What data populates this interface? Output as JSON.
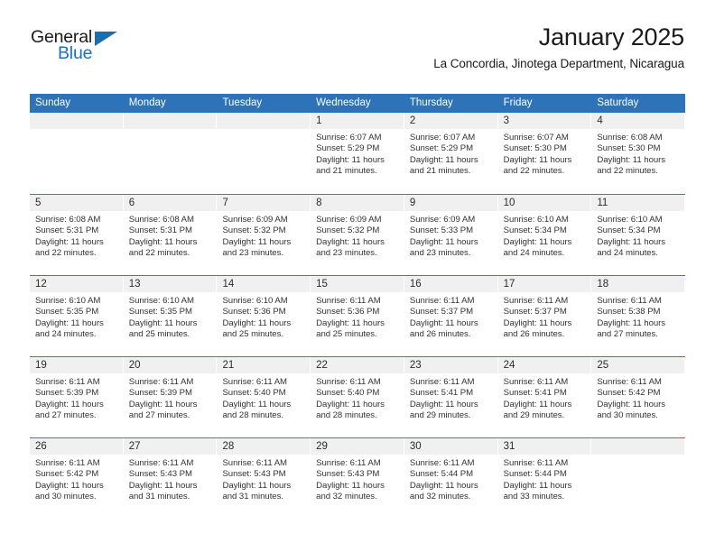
{
  "brand": {
    "word_one": "General",
    "word_two": "Blue",
    "triangle_icon": "triangle-icon",
    "accent_color": "#1673c4",
    "triangle_color": "#1b6cb0"
  },
  "header": {
    "title": "January 2025",
    "subtitle": "La Concordia, Jinotega Department, Nicaragua"
  },
  "colors": {
    "header_bar": "#2e72b8",
    "week_divider": "#3a7cbe",
    "day_band": "#f0f0f0",
    "text": "#333333"
  },
  "calendar": {
    "day_headers": [
      "Sunday",
      "Monday",
      "Tuesday",
      "Wednesday",
      "Thursday",
      "Friday",
      "Saturday"
    ],
    "weeks": [
      [
        {
          "day": "",
          "sunrise": "",
          "sunset": "",
          "daylight_1": "",
          "daylight_2": "",
          "empty": true
        },
        {
          "day": "",
          "sunrise": "",
          "sunset": "",
          "daylight_1": "",
          "daylight_2": "",
          "empty": true
        },
        {
          "day": "",
          "sunrise": "",
          "sunset": "",
          "daylight_1": "",
          "daylight_2": "",
          "empty": true
        },
        {
          "day": "1",
          "sunrise": "Sunrise: 6:07 AM",
          "sunset": "Sunset: 5:29 PM",
          "daylight_1": "Daylight: 11 hours",
          "daylight_2": "and 21 minutes."
        },
        {
          "day": "2",
          "sunrise": "Sunrise: 6:07 AM",
          "sunset": "Sunset: 5:29 PM",
          "daylight_1": "Daylight: 11 hours",
          "daylight_2": "and 21 minutes."
        },
        {
          "day": "3",
          "sunrise": "Sunrise: 6:07 AM",
          "sunset": "Sunset: 5:30 PM",
          "daylight_1": "Daylight: 11 hours",
          "daylight_2": "and 22 minutes."
        },
        {
          "day": "4",
          "sunrise": "Sunrise: 6:08 AM",
          "sunset": "Sunset: 5:30 PM",
          "daylight_1": "Daylight: 11 hours",
          "daylight_2": "and 22 minutes."
        }
      ],
      [
        {
          "day": "5",
          "sunrise": "Sunrise: 6:08 AM",
          "sunset": "Sunset: 5:31 PM",
          "daylight_1": "Daylight: 11 hours",
          "daylight_2": "and 22 minutes."
        },
        {
          "day": "6",
          "sunrise": "Sunrise: 6:08 AM",
          "sunset": "Sunset: 5:31 PM",
          "daylight_1": "Daylight: 11 hours",
          "daylight_2": "and 22 minutes."
        },
        {
          "day": "7",
          "sunrise": "Sunrise: 6:09 AM",
          "sunset": "Sunset: 5:32 PM",
          "daylight_1": "Daylight: 11 hours",
          "daylight_2": "and 23 minutes."
        },
        {
          "day": "8",
          "sunrise": "Sunrise: 6:09 AM",
          "sunset": "Sunset: 5:32 PM",
          "daylight_1": "Daylight: 11 hours",
          "daylight_2": "and 23 minutes."
        },
        {
          "day": "9",
          "sunrise": "Sunrise: 6:09 AM",
          "sunset": "Sunset: 5:33 PM",
          "daylight_1": "Daylight: 11 hours",
          "daylight_2": "and 23 minutes."
        },
        {
          "day": "10",
          "sunrise": "Sunrise: 6:10 AM",
          "sunset": "Sunset: 5:34 PM",
          "daylight_1": "Daylight: 11 hours",
          "daylight_2": "and 24 minutes."
        },
        {
          "day": "11",
          "sunrise": "Sunrise: 6:10 AM",
          "sunset": "Sunset: 5:34 PM",
          "daylight_1": "Daylight: 11 hours",
          "daylight_2": "and 24 minutes."
        }
      ],
      [
        {
          "day": "12",
          "sunrise": "Sunrise: 6:10 AM",
          "sunset": "Sunset: 5:35 PM",
          "daylight_1": "Daylight: 11 hours",
          "daylight_2": "and 24 minutes."
        },
        {
          "day": "13",
          "sunrise": "Sunrise: 6:10 AM",
          "sunset": "Sunset: 5:35 PM",
          "daylight_1": "Daylight: 11 hours",
          "daylight_2": "and 25 minutes."
        },
        {
          "day": "14",
          "sunrise": "Sunrise: 6:10 AM",
          "sunset": "Sunset: 5:36 PM",
          "daylight_1": "Daylight: 11 hours",
          "daylight_2": "and 25 minutes."
        },
        {
          "day": "15",
          "sunrise": "Sunrise: 6:11 AM",
          "sunset": "Sunset: 5:36 PM",
          "daylight_1": "Daylight: 11 hours",
          "daylight_2": "and 25 minutes."
        },
        {
          "day": "16",
          "sunrise": "Sunrise: 6:11 AM",
          "sunset": "Sunset: 5:37 PM",
          "daylight_1": "Daylight: 11 hours",
          "daylight_2": "and 26 minutes."
        },
        {
          "day": "17",
          "sunrise": "Sunrise: 6:11 AM",
          "sunset": "Sunset: 5:37 PM",
          "daylight_1": "Daylight: 11 hours",
          "daylight_2": "and 26 minutes."
        },
        {
          "day": "18",
          "sunrise": "Sunrise: 6:11 AM",
          "sunset": "Sunset: 5:38 PM",
          "daylight_1": "Daylight: 11 hours",
          "daylight_2": "and 27 minutes."
        }
      ],
      [
        {
          "day": "19",
          "sunrise": "Sunrise: 6:11 AM",
          "sunset": "Sunset: 5:39 PM",
          "daylight_1": "Daylight: 11 hours",
          "daylight_2": "and 27 minutes."
        },
        {
          "day": "20",
          "sunrise": "Sunrise: 6:11 AM",
          "sunset": "Sunset: 5:39 PM",
          "daylight_1": "Daylight: 11 hours",
          "daylight_2": "and 27 minutes."
        },
        {
          "day": "21",
          "sunrise": "Sunrise: 6:11 AM",
          "sunset": "Sunset: 5:40 PM",
          "daylight_1": "Daylight: 11 hours",
          "daylight_2": "and 28 minutes."
        },
        {
          "day": "22",
          "sunrise": "Sunrise: 6:11 AM",
          "sunset": "Sunset: 5:40 PM",
          "daylight_1": "Daylight: 11 hours",
          "daylight_2": "and 28 minutes."
        },
        {
          "day": "23",
          "sunrise": "Sunrise: 6:11 AM",
          "sunset": "Sunset: 5:41 PM",
          "daylight_1": "Daylight: 11 hours",
          "daylight_2": "and 29 minutes."
        },
        {
          "day": "24",
          "sunrise": "Sunrise: 6:11 AM",
          "sunset": "Sunset: 5:41 PM",
          "daylight_1": "Daylight: 11 hours",
          "daylight_2": "and 29 minutes."
        },
        {
          "day": "25",
          "sunrise": "Sunrise: 6:11 AM",
          "sunset": "Sunset: 5:42 PM",
          "daylight_1": "Daylight: 11 hours",
          "daylight_2": "and 30 minutes."
        }
      ],
      [
        {
          "day": "26",
          "sunrise": "Sunrise: 6:11 AM",
          "sunset": "Sunset: 5:42 PM",
          "daylight_1": "Daylight: 11 hours",
          "daylight_2": "and 30 minutes."
        },
        {
          "day": "27",
          "sunrise": "Sunrise: 6:11 AM",
          "sunset": "Sunset: 5:43 PM",
          "daylight_1": "Daylight: 11 hours",
          "daylight_2": "and 31 minutes."
        },
        {
          "day": "28",
          "sunrise": "Sunrise: 6:11 AM",
          "sunset": "Sunset: 5:43 PM",
          "daylight_1": "Daylight: 11 hours",
          "daylight_2": "and 31 minutes."
        },
        {
          "day": "29",
          "sunrise": "Sunrise: 6:11 AM",
          "sunset": "Sunset: 5:43 PM",
          "daylight_1": "Daylight: 11 hours",
          "daylight_2": "and 32 minutes."
        },
        {
          "day": "30",
          "sunrise": "Sunrise: 6:11 AM",
          "sunset": "Sunset: 5:44 PM",
          "daylight_1": "Daylight: 11 hours",
          "daylight_2": "and 32 minutes."
        },
        {
          "day": "31",
          "sunrise": "Sunrise: 6:11 AM",
          "sunset": "Sunset: 5:44 PM",
          "daylight_1": "Daylight: 11 hours",
          "daylight_2": "and 33 minutes."
        },
        {
          "day": "",
          "sunrise": "",
          "sunset": "",
          "daylight_1": "",
          "daylight_2": "",
          "empty": true
        }
      ]
    ]
  }
}
